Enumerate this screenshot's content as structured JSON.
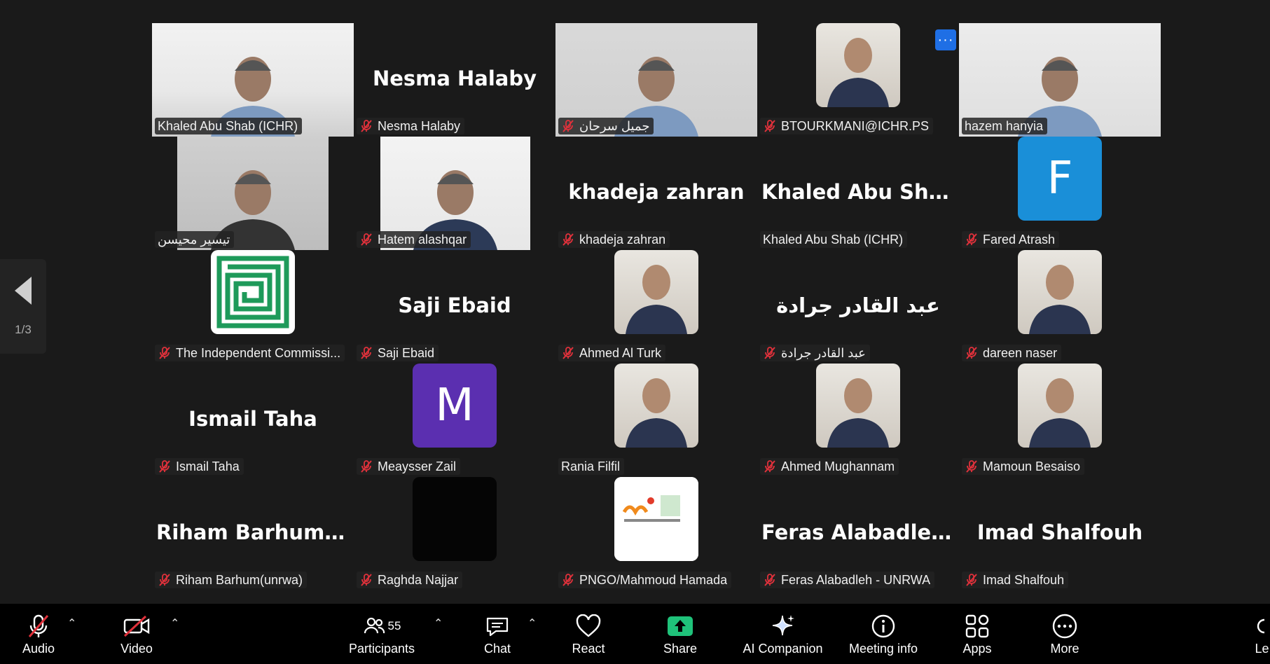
{
  "gallery": {
    "page_indicator": "1/3",
    "more_button": "···",
    "participants": [
      {
        "name": "Khaled Abu Shab (ICHR)",
        "display": "video",
        "muted": false,
        "speaking": false
      },
      {
        "name": "Nesma Halaby",
        "display": "name",
        "big_name": "Nesma Halaby",
        "muted": true
      },
      {
        "name": "جميل سرحان",
        "display": "video",
        "muted": true
      },
      {
        "name": "BTOURKMANI@ICHR.PS",
        "display": "avatar-photo",
        "muted": true
      },
      {
        "name": "hazem hanyia",
        "display": "video",
        "muted": false,
        "speaking": true
      },
      {
        "name": "تيسير محيسن",
        "display": "video",
        "muted": false
      },
      {
        "name": "Hatem alashqar",
        "display": "video",
        "muted": true
      },
      {
        "name": "khadeja zahran",
        "display": "name",
        "big_name": "khadeja zahran",
        "muted": true
      },
      {
        "name": "Khaled Abu Shab (ICHR)",
        "display": "name",
        "big_name": "Khaled  Abu  Sha...",
        "muted": false
      },
      {
        "name": "Fared Atrash",
        "display": "avatar-letter",
        "letter": "F",
        "color": "#1a8fd8",
        "muted": true
      },
      {
        "name": "The Independent Commissi...",
        "display": "avatar-logo",
        "muted": true
      },
      {
        "name": "Saji Ebaid",
        "display": "name",
        "big_name": "Saji Ebaid",
        "muted": true
      },
      {
        "name": "Ahmed Al Turk",
        "display": "avatar-photo",
        "muted": true
      },
      {
        "name": "عبد القادر جرادة",
        "display": "name",
        "big_name": "عبد القادر جرادة",
        "muted": true
      },
      {
        "name": "dareen naser",
        "display": "avatar-photo",
        "muted": true
      },
      {
        "name": "Ismail Taha",
        "display": "name",
        "big_name": "Ismail Taha",
        "muted": true
      },
      {
        "name": "Meaysser Zail",
        "display": "avatar-letter",
        "letter": "M",
        "color": "#5b2fb0",
        "muted": true
      },
      {
        "name": "Rania Filfil",
        "display": "avatar-photo",
        "muted": false
      },
      {
        "name": "Ahmed Mughannam",
        "display": "avatar-photo",
        "muted": true
      },
      {
        "name": "Mamoun Besaiso",
        "display": "avatar-photo",
        "muted": true
      },
      {
        "name": "Riham Barhum(unrwa)",
        "display": "name",
        "big_name": "Riham  Barhum(...",
        "muted": true
      },
      {
        "name": "Raghda Najjar",
        "display": "avatar-black",
        "muted": true
      },
      {
        "name": "PNGO/Mahmoud Hamada",
        "display": "avatar-logo2",
        "muted": true
      },
      {
        "name": "Feras Alabadleh - UNRWA",
        "display": "name",
        "big_name": "Feras  Alabadleh...",
        "muted": true
      },
      {
        "name": "Imad Shalfouh",
        "display": "name",
        "big_name": "Imad Shalfouh",
        "muted": true
      }
    ]
  },
  "toolbar": {
    "audio": "Audio",
    "video": "Video",
    "participants": "Participants",
    "participants_count": "55",
    "chat": "Chat",
    "react": "React",
    "share": "Share",
    "ai_companion": "AI Companion",
    "meeting_info": "Meeting info",
    "apps": "Apps",
    "more": "More",
    "leave": "Le",
    "share_color": "#1fc27a",
    "muted_color": "#e0313b"
  }
}
